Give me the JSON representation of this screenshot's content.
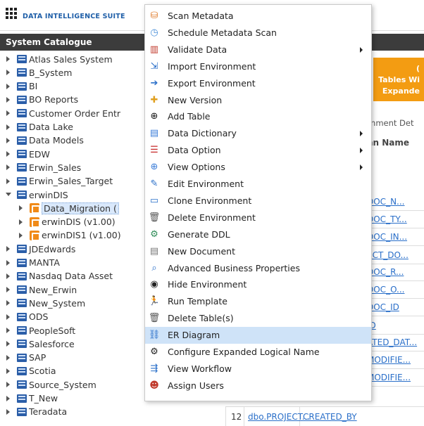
{
  "header": {
    "brand": "DATA INTELLIGENCE SUITE"
  },
  "catalog": {
    "title": "System Catalogue",
    "items": [
      {
        "label": "Atlas Sales System",
        "type": "db",
        "indent": 0,
        "expanded": false
      },
      {
        "label": "B_System",
        "type": "db",
        "indent": 0,
        "expanded": false
      },
      {
        "label": "BI",
        "type": "db",
        "indent": 0,
        "expanded": false
      },
      {
        "label": "BO Reports",
        "type": "db",
        "indent": 0,
        "expanded": false
      },
      {
        "label": "Customer Order Entr",
        "type": "db",
        "indent": 0,
        "expanded": false
      },
      {
        "label": "Data Lake",
        "type": "db",
        "indent": 0,
        "expanded": false
      },
      {
        "label": "Data Models",
        "type": "db",
        "indent": 0,
        "expanded": false
      },
      {
        "label": "EDW",
        "type": "db",
        "indent": 0,
        "expanded": false
      },
      {
        "label": "Erwin_Sales",
        "type": "db",
        "indent": 0,
        "expanded": false
      },
      {
        "label": "Erwin_Sales_Target",
        "type": "db",
        "indent": 0,
        "expanded": false
      },
      {
        "label": "erwinDIS",
        "type": "db",
        "indent": 0,
        "expanded": true
      },
      {
        "label": "Data_Migration (",
        "type": "model",
        "indent": 1,
        "expanded": false,
        "selected": true
      },
      {
        "label": "erwinDIS (v1.00)",
        "type": "model",
        "indent": 1,
        "expanded": false
      },
      {
        "label": "erwinDIS1 (v1.00)",
        "type": "model",
        "indent": 1,
        "expanded": false
      },
      {
        "label": "JDEdwards",
        "type": "db",
        "indent": 0,
        "expanded": false
      },
      {
        "label": "MANTA",
        "type": "db",
        "indent": 0,
        "expanded": false
      },
      {
        "label": "Nasdaq Data Asset",
        "type": "db",
        "indent": 0,
        "expanded": false
      },
      {
        "label": "New_Erwin",
        "type": "db",
        "indent": 0,
        "expanded": false
      },
      {
        "label": "New_System",
        "type": "db",
        "indent": 0,
        "expanded": false
      },
      {
        "label": "ODS",
        "type": "db",
        "indent": 0,
        "expanded": false
      },
      {
        "label": "PeopleSoft",
        "type": "db",
        "indent": 0,
        "expanded": false
      },
      {
        "label": "Salesforce",
        "type": "db",
        "indent": 0,
        "expanded": false
      },
      {
        "label": "SAP",
        "type": "db",
        "indent": 0,
        "expanded": false
      },
      {
        "label": "Scotia",
        "type": "db",
        "indent": 0,
        "expanded": false
      },
      {
        "label": "Source_System",
        "type": "db",
        "indent": 0,
        "expanded": false
      },
      {
        "label": "T_New",
        "type": "db",
        "indent": 0,
        "expanded": false
      },
      {
        "label": "Teradata",
        "type": "db",
        "indent": 0,
        "expanded": false
      }
    ]
  },
  "right": {
    "card_line1": "(",
    "card_line2": "Tables Wi",
    "card_line3": "Expande",
    "env_tab": "onment Det",
    "column_header": "nn Name",
    "links": [
      "DOC_N...",
      "DOC_TY...",
      "DOC_IN...",
      "ECT_DO...",
      "DOC_R...",
      "DOC_O...",
      "DOC_ID",
      "ID",
      "ATED_DAT...",
      "MODIFIE...",
      "MODIFIE..."
    ],
    "last_row": {
      "num": "12",
      "table": "dbo.PROJECT...",
      "column": "CREATED_BY"
    }
  },
  "menu": {
    "items": [
      {
        "label": "Scan Metadata",
        "icon": "scan-metadata-icon",
        "glyph": "⛁",
        "color": "#e07b2a",
        "submenu": false
      },
      {
        "label": "Schedule Metadata Scan",
        "icon": "schedule-icon",
        "glyph": "◷",
        "color": "#4a90d9",
        "submenu": false
      },
      {
        "label": "Validate Data",
        "icon": "validate-chart-icon",
        "glyph": "▥",
        "color": "#c0392b",
        "submenu": true
      },
      {
        "label": "Import Environment",
        "icon": "import-icon",
        "glyph": "⇲",
        "color": "#2a6fc9",
        "submenu": false
      },
      {
        "label": "Export Environment",
        "icon": "export-icon",
        "glyph": "➔",
        "color": "#2a6fc9",
        "submenu": false
      },
      {
        "label": "New Version",
        "icon": "new-version-icon",
        "glyph": "✚",
        "color": "#e0a020",
        "submenu": false
      },
      {
        "label": "Add Table",
        "icon": "add-table-icon",
        "glyph": "⊕",
        "color": "#111111",
        "submenu": false
      },
      {
        "label": "Data Dictionary",
        "icon": "data-dictionary-icon",
        "glyph": "▤",
        "color": "#3b7dd8",
        "submenu": true
      },
      {
        "label": "Data Option",
        "icon": "data-option-icon",
        "glyph": "☰",
        "color": "#c62828",
        "submenu": true
      },
      {
        "label": "View Options",
        "icon": "view-options-icon",
        "glyph": "⊕",
        "color": "#3b7dd8",
        "submenu": true
      },
      {
        "label": "Edit Environment",
        "icon": "edit-icon",
        "glyph": "✎",
        "color": "#2a6fc9",
        "submenu": false
      },
      {
        "label": "Clone Environment",
        "icon": "clone-icon",
        "glyph": "▭",
        "color": "#2a6fc9",
        "submenu": false
      },
      {
        "label": "Delete Environment",
        "icon": "trash-icon",
        "glyph": "🗑",
        "color": "#555555",
        "submenu": false
      },
      {
        "label": "Generate DDL",
        "icon": "generate-ddl-icon",
        "glyph": "⚙",
        "color": "#2e8b57",
        "submenu": false
      },
      {
        "label": "New Document",
        "icon": "new-document-icon",
        "glyph": "▤",
        "color": "#777777",
        "submenu": false
      },
      {
        "label": "Advanced Business Properties",
        "icon": "business-properties-icon",
        "glyph": "⌕",
        "color": "#2a6fc9",
        "submenu": false
      },
      {
        "label": "Hide Environment",
        "icon": "eye-icon",
        "glyph": "◉",
        "color": "#222222",
        "submenu": false
      },
      {
        "label": "Run Template",
        "icon": "run-icon",
        "glyph": "🏃",
        "color": "#222222",
        "submenu": false
      },
      {
        "label": "Delete Table(s)",
        "icon": "trash-icon",
        "glyph": "🗑",
        "color": "#555555",
        "submenu": false
      },
      {
        "label": "ER Diagram",
        "icon": "er-diagram-icon",
        "glyph": "⛓",
        "color": "#2a6fc9",
        "submenu": false,
        "hover": true
      },
      {
        "label": "Configure Expanded Logical Name",
        "icon": "gear-icon",
        "glyph": "⚙",
        "color": "#222222",
        "submenu": false
      },
      {
        "label": "View Workflow",
        "icon": "workflow-icon",
        "glyph": "⇶",
        "color": "#2a6fc9",
        "submenu": false
      },
      {
        "label": "Assign Users",
        "icon": "user-icon",
        "glyph": "☻",
        "color": "#c0392b",
        "submenu": false
      }
    ]
  }
}
